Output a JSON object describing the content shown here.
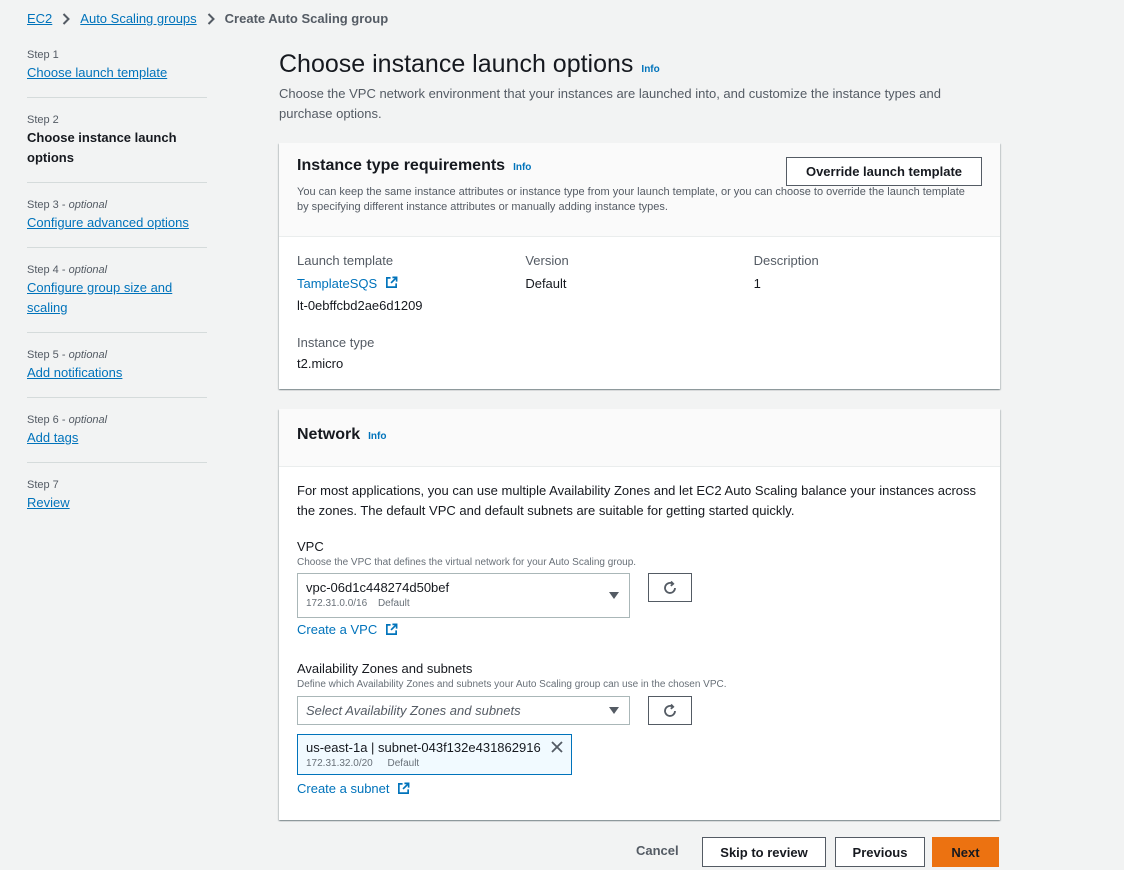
{
  "breadcrumb": {
    "items": [
      "EC2",
      "Auto Scaling groups"
    ],
    "current": "Create Auto Scaling group"
  },
  "steps": [
    {
      "label": "Step 1",
      "optional": "",
      "title": "Choose launch template",
      "current": false
    },
    {
      "label": "Step 2",
      "optional": "",
      "title": "Choose instance launch options",
      "current": true
    },
    {
      "label": "Step 3 - ",
      "optional": "optional",
      "title": "Configure advanced options",
      "current": false
    },
    {
      "label": "Step 4 - ",
      "optional": "optional",
      "title": "Configure group size and scaling",
      "current": false
    },
    {
      "label": "Step 5 - ",
      "optional": "optional",
      "title": "Add notifications",
      "current": false
    },
    {
      "label": "Step 6 - ",
      "optional": "optional",
      "title": "Add tags",
      "current": false
    },
    {
      "label": "Step 7",
      "optional": "",
      "title": "Review",
      "current": false
    }
  ],
  "page": {
    "title": "Choose instance launch options",
    "info": "Info",
    "description": "Choose the VPC network environment that your instances are launched into, and customize the instance types and purchase options."
  },
  "instance_card": {
    "title": "Instance type requirements",
    "info": "Info",
    "override_button": "Override launch template",
    "description": "You can keep the same instance attributes or instance type from your launch template, or you can choose to override the launch template by specifying different instance attributes or manually adding instance types.",
    "launch_template_label": "Launch template",
    "launch_template_name": "TamplateSQS",
    "launch_template_id": "lt-0ebffcbd2ae6d1209",
    "version_label": "Version",
    "version_value": "Default",
    "description_label": "Description",
    "description_value": "1",
    "instance_type_label": "Instance type",
    "instance_type_value": "t2.micro"
  },
  "network_card": {
    "title": "Network",
    "info": "Info",
    "intro": "For most applications, you can use multiple Availability Zones and let EC2 Auto Scaling balance your instances across the zones. The default VPC and default subnets are suitable for getting started quickly.",
    "vpc_label": "VPC",
    "vpc_help": "Choose the VPC that defines the virtual network for your Auto Scaling group.",
    "vpc_value": "vpc-06d1c448274d50bef",
    "vpc_cidr": "172.31.0.0/16",
    "vpc_default": "Default",
    "create_vpc": "Create a VPC",
    "az_label": "Availability Zones and subnets",
    "az_help": "Define which Availability Zones and subnets your Auto Scaling group can use in the chosen VPC.",
    "az_placeholder": "Select Availability Zones and subnets",
    "subnet_token": "us-east-1a | subnet-043f132e431862916",
    "subnet_cidr": "172.31.32.0/20",
    "subnet_default": "Default",
    "create_subnet": "Create a subnet"
  },
  "footer": {
    "cancel": "Cancel",
    "skip": "Skip to review",
    "previous": "Previous",
    "next": "Next"
  },
  "colors": {
    "accent": "#ec7211",
    "link": "#0073bb",
    "background": "#f2f3f3"
  },
  "icons": [
    "chevron-right-icon",
    "external-link-icon",
    "refresh-icon",
    "caret-down-icon",
    "close-icon"
  ]
}
